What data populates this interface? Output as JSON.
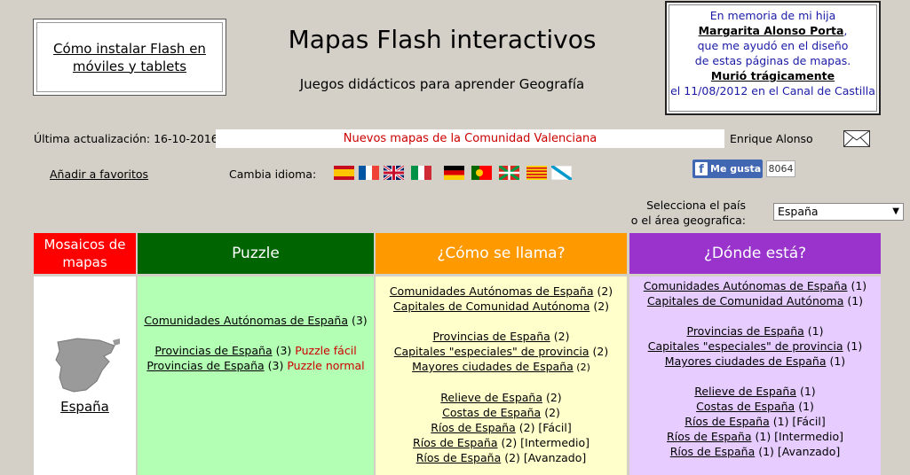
{
  "header": {
    "flash_link": "Cómo instalar Flash en móviles y tablets",
    "title": "Mapas Flash interactivos",
    "subtitle": "Juegos didácticos para aprender Geografía"
  },
  "memorial": {
    "line1": "En memoria de mi hija",
    "name": "Margarita Alonso Porta",
    "name_suffix": ",",
    "line3": "que me ayudó en el diseño",
    "line4": "de estas páginas de mapas.",
    "line5": "Murió trágicamente",
    "line6": "el 11/08/2012 en el Canal de Castilla"
  },
  "info_bar": {
    "update_label": "Última actualización: 16-10-2016",
    "news": "Nuevos mapas de la Comunidad Valenciana",
    "author": "Enrique Alonso",
    "mail_icon": "envelope-icon"
  },
  "toolbar": {
    "favorites": "Añadir a favoritos",
    "language_label": "Cambia idioma:",
    "flags": [
      "spain",
      "france",
      "uk",
      "italy",
      "germany",
      "portugal",
      "basque",
      "catalonia",
      "galicia"
    ],
    "facebook_like": "Me gusta",
    "facebook_count": "8064"
  },
  "country": {
    "label_line1": "Selecciona el país",
    "label_line2": "o el área geografica:",
    "selected": "España"
  },
  "columns": {
    "mosaics": {
      "title": "Mosaicos de mapas",
      "map_label": "España",
      "color": "#ff0000"
    },
    "puzzle": {
      "title": "Puzzle",
      "color": "#006400",
      "bg": "#b3ffb3",
      "items": [
        {
          "link": "Comunidades Autónomas de España",
          "count": " (3)",
          "note": ""
        },
        {
          "link": "Provincias de España",
          "count": " (3)",
          "note": " Puzzle fácil"
        },
        {
          "link": "Provincias de España",
          "count": " (3)",
          "note": " Puzzle normal"
        }
      ]
    },
    "name": {
      "title": "¿Cómo se llama?",
      "color": "#ff9900",
      "bg": "#ffffcc",
      "items": [
        {
          "link": "Comunidades Autónomas de España",
          "count": " (2)"
        },
        {
          "link": "Capitales de Comunidad Autónoma",
          "count": " (2)"
        },
        {
          "link": "Provincias de España",
          "count": " (2)"
        },
        {
          "link": "Capitales \"especiales\" de provincia",
          "count": " (2)"
        },
        {
          "link": "Mayores ciudades de España",
          "count": " (2)"
        },
        {
          "link": "Relieve de España",
          "count": " (2)"
        },
        {
          "link": "Costas de España",
          "count": " (2)"
        },
        {
          "link": "Ríos de España",
          "count": " (2) [Fácil]"
        },
        {
          "link": "Ríos de España",
          "count": " (2) [Intermedio]"
        },
        {
          "link": "Ríos de España",
          "count": " (2) [Avanzado]"
        }
      ]
    },
    "where": {
      "title": "¿Dónde está?",
      "color": "#9933cc",
      "bg": "#e6ccff",
      "items": [
        {
          "link": "Comunidades Autónomas de España",
          "count": " (1)"
        },
        {
          "link": "Capitales de Comunidad Autónoma",
          "count": " (1)"
        },
        {
          "link": "Provincias de España",
          "count": " (1)"
        },
        {
          "link": "Capitales \"especiales\" de provincia",
          "count": " (1)"
        },
        {
          "link": "Mayores ciudades de España",
          "count": " (1)"
        },
        {
          "link": "Relieve de España",
          "count": " (1)"
        },
        {
          "link": "Costas de España",
          "count": " (1)"
        },
        {
          "link": "Ríos de España",
          "count": " (1) [Fácil]"
        },
        {
          "link": "Ríos de España",
          "count": " (1) [Intermedio]"
        },
        {
          "link": "Ríos de España",
          "count": " (1) [Avanzado]"
        }
      ]
    }
  }
}
